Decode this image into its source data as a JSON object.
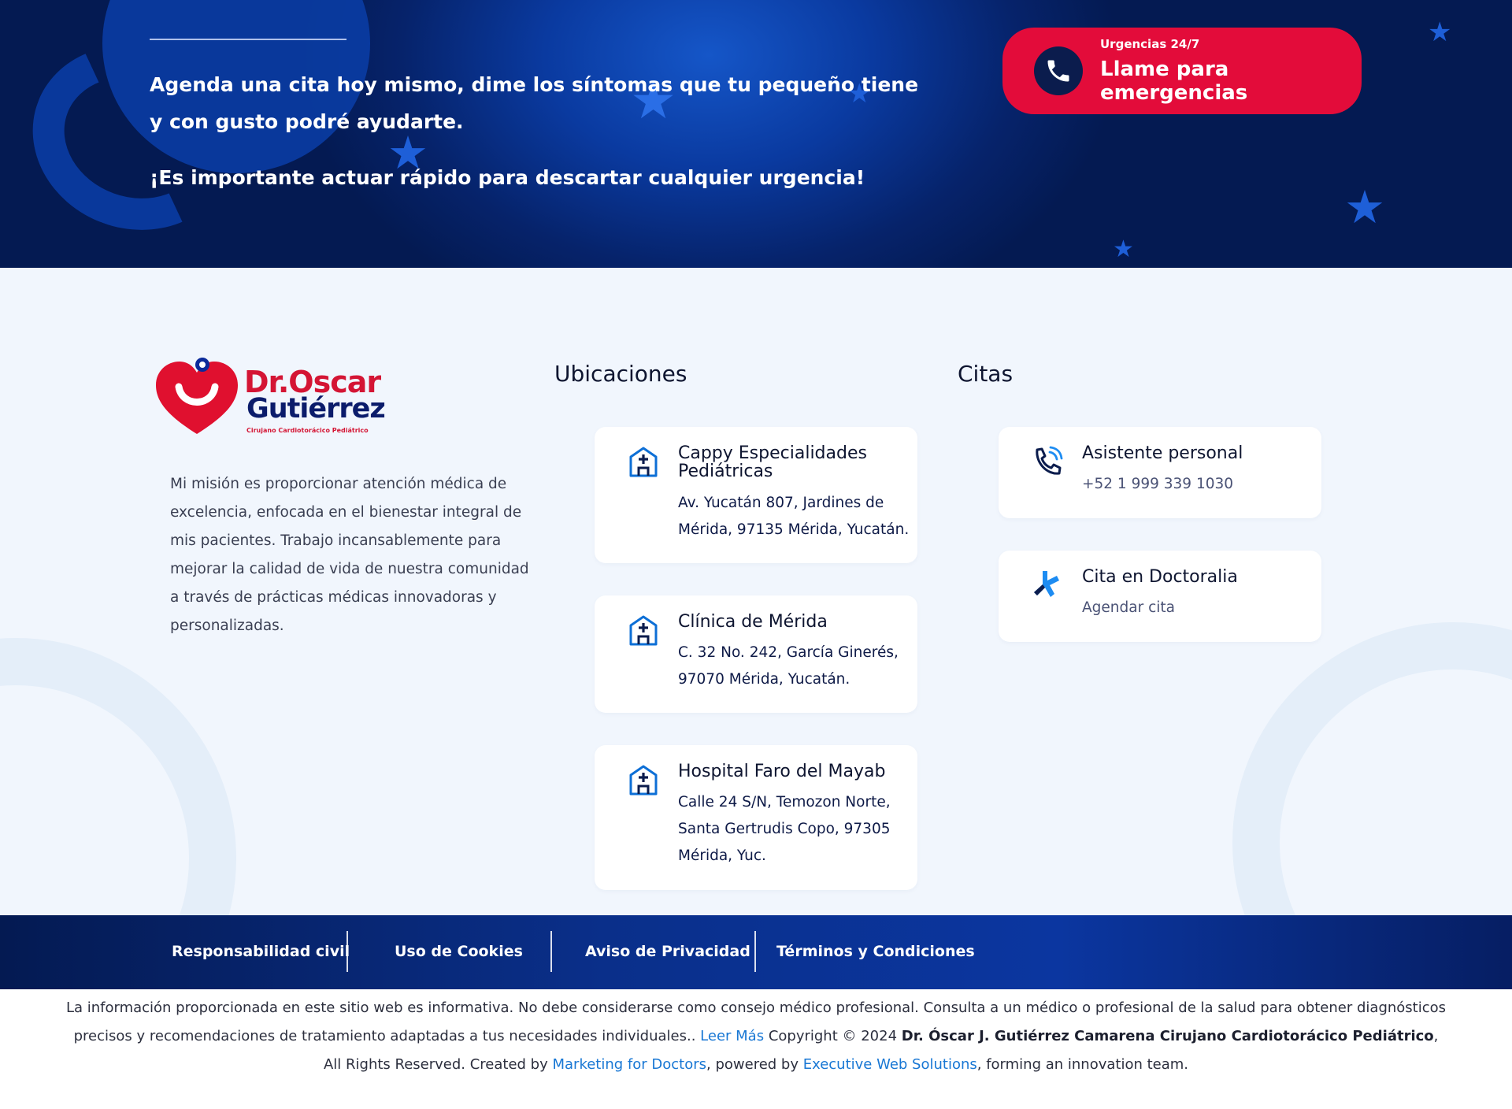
{
  "hero": {
    "message": "Agenda una cita hoy mismo, dime los síntomas que tu pequeño tiene y con gusto podré ayudarte.",
    "urgent_text": "¡Es importante actuar rápido para descartar cualquier urgencia!",
    "cta_small": "Urgencias 24/7",
    "cta_big": "Llame para emergencias",
    "colors": {
      "cta_bg": "#e30c3a",
      "hero_bg": "#06236b"
    }
  },
  "brand": {
    "logo_line1": "Dr.Oscar",
    "logo_line2": "Gutiérrez",
    "logo_line3": "Cirujano Cardiotorácico Pediátrico",
    "mission": "Mi misión es proporcionar atención médica de excelencia, enfocada en el bienestar integral de mis pacientes. Trabajo incansablemente para mejorar la calidad de vida de nuestra comunidad a través de prácticas médicas innovadoras y personalizadas."
  },
  "locations": {
    "title": "Ubicaciones",
    "items": [
      {
        "name": "Cappy Especialidades Pediátricas",
        "address": "Av. Yucatán 807, Jardines de Mérida, 97135 Mérida, Yucatán.",
        "icon": "hospital-icon"
      },
      {
        "name": "Clínica de Mérida",
        "address": "C. 32 No. 242, García Ginerés, 97070 Mérida, Yucatán.",
        "icon": "hospital-icon"
      },
      {
        "name": "Hospital Faro del Mayab",
        "address": "Calle 24 S/N, Temozon Norte, Santa Gertrudis Copo, 97305 Mérida, Yuc.",
        "icon": "hospital-icon"
      }
    ]
  },
  "appointments": {
    "title": "Citas",
    "items": [
      {
        "name": "Asistente personal",
        "detail": "+52 1 999 339 1030",
        "icon": "phone-call-icon"
      },
      {
        "name": "Cita en Doctoralia",
        "detail": "Agendar cita",
        "icon": "doctoralia-icon"
      }
    ]
  },
  "footer_nav": [
    {
      "label": "Responsabilidad civil"
    },
    {
      "label": "Uso de Cookies"
    },
    {
      "label": "Aviso de Privacidad"
    },
    {
      "label": "Términos y Condiciones"
    }
  ],
  "disclaimer": {
    "text1": "La información proporcionada en este sitio web es informativa. No debe considerarse como consejo médico profesional. Consulta a un médico o profesional de la salud para obtener diagnósticos precisos y recomendaciones de tratamiento adaptadas a tus necesidades individuales.. ",
    "read_more": "Leer Más",
    "text2": " Copyright © 2024 ",
    "owner": "Dr. Óscar J. Gutiérrez Camarena Cirujano Cardiotorácico Pediátrico",
    "text3": ", All Rights Reserved. Created by ",
    "link1": "Marketing for Doctors",
    "text4": ", powered by ",
    "link2": "Executive Web Solutions",
    "text5": ", forming an innovation team."
  }
}
